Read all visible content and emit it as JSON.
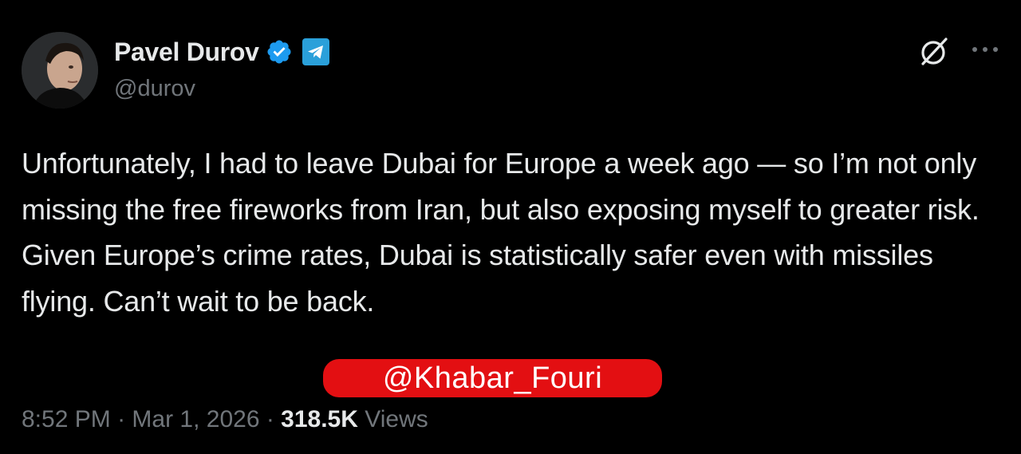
{
  "author": {
    "display_name": "Pavel Durov",
    "handle": "@durov",
    "avatar": "profile-photo",
    "verified_badge_color": "#1d9bf0",
    "affiliate_badge": "telegram-icon",
    "affiliate_badge_color": "#2aa0da"
  },
  "header_actions": {
    "grok_icon": "grok-icon",
    "more_icon": "more-dots-icon"
  },
  "tweet": {
    "text": "Unfortunately, I had to leave Dubai for Europe a week ago — so I’m not only missing the free fireworks from Iran, but also exposing myself to greater risk. Given Europe’s crime rates, Dubai is statistically safer even with missiles flying. Can’t wait to be back."
  },
  "watermark": {
    "text": "@Khabar_Fouri",
    "color": "#e30f12"
  },
  "meta": {
    "time": "8:52 PM",
    "separator1": " · ",
    "date": "Mar 1, 2026",
    "separator2": " · ",
    "views_count": "318.5K",
    "views_label": " Views"
  }
}
